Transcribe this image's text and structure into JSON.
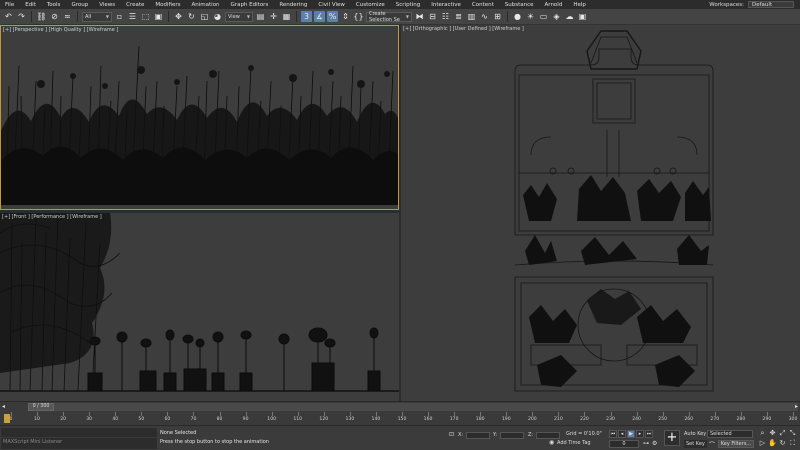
{
  "menu": {
    "items": [
      "File",
      "Edit",
      "Tools",
      "Group",
      "Views",
      "Create",
      "Modifiers",
      "Animation",
      "Graph Editors",
      "Rendering",
      "Civil View",
      "Customize",
      "Scripting",
      "Interactive",
      "Content",
      "Substance",
      "Arnold",
      "Help"
    ],
    "workspace_label": "Workspaces:",
    "workspace_value": "Default"
  },
  "toolbar": {
    "selection_filter": "All",
    "coord_system": "View",
    "named_selection_placeholder": "Create Selection Se"
  },
  "viewports": {
    "perspective_label": "[+] [Perspective ] [High Quality ] [Wireframe ]",
    "front_label": "[+] [Front ] [Performance ] [Wireframe ]",
    "ortho_label": "[+] [Orthographic ] [User Defined ] [Wireframe ]"
  },
  "timeline": {
    "frame_display": "0 / 300",
    "current_frame": 0,
    "total_frames": 300,
    "ticks": [
      "0",
      "10",
      "20",
      "30",
      "40",
      "50",
      "60",
      "70",
      "80",
      "90",
      "100",
      "110",
      "120",
      "130",
      "140",
      "150",
      "160",
      "170",
      "180",
      "190",
      "200",
      "210",
      "220",
      "230",
      "240",
      "250",
      "260",
      "270",
      "280",
      "290",
      "300"
    ]
  },
  "status": {
    "listener_line1": "",
    "listener_line2": "MAXScript Mini Listener",
    "selection_status": "None Selected",
    "prompt": "Press the stop button to stop the animation",
    "x_label": "X:",
    "y_label": "Y:",
    "z_label": "Z:",
    "grid": "Grid = 0'10.0\"",
    "add_time_tag": "Add Time Tag",
    "frame_value": "0",
    "auto_key": "Auto Key",
    "set_key": "Set Key",
    "selected_option": "Selected",
    "key_filters": "Key Filters..."
  }
}
